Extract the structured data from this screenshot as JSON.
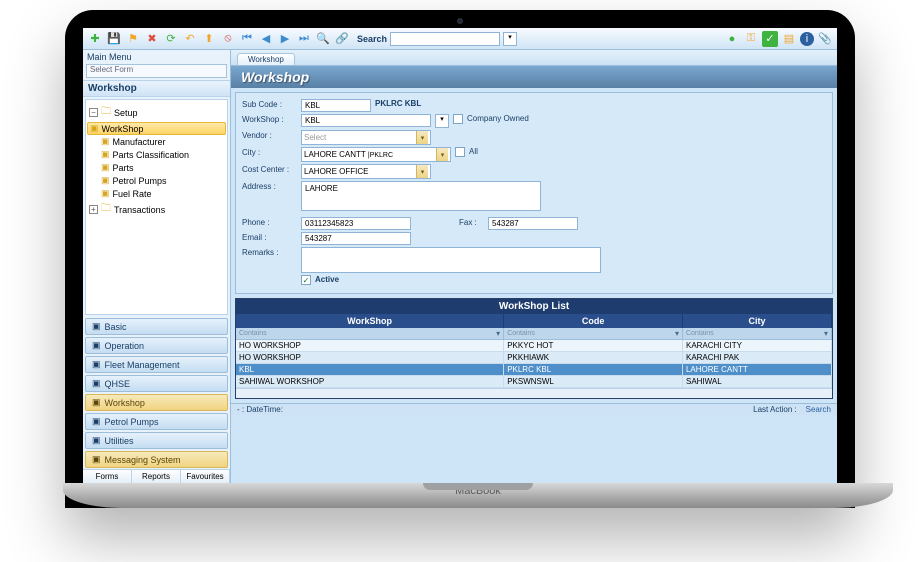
{
  "toolbar": {
    "search_label": "Search",
    "search_value": ""
  },
  "sidebar": {
    "main_menu": "Main Menu",
    "select_form": "Select Form",
    "module_title": "Workshop",
    "tree": {
      "root": "Setup",
      "children": [
        "WorkShop",
        "Manufacturer",
        "Parts Classification",
        "Parts",
        "Petrol Pumps",
        "Fuel Rate"
      ],
      "sibling": "Transactions"
    },
    "stack": [
      "Basic",
      "Operation",
      "Fleet Management",
      "QHSE",
      "Workshop",
      "Petrol Pumps",
      "Utilities",
      "Messaging System"
    ],
    "bottom_tabs": [
      "Forms",
      "Reports",
      "Favourites"
    ]
  },
  "content": {
    "tab": "Workshop",
    "title": "Workshop",
    "form": {
      "sub_code_label": "Sub Code :",
      "sub_code_value": "KBL",
      "sub_code_display": "PKLRC KBL",
      "workshop_label": "WorkShop :",
      "workshop_value": "KBL",
      "company_owned": "Company Owned",
      "vendor_label": "Vendor :",
      "vendor_value": "Select",
      "city_label": "City :",
      "city_value": "LAHORE CANTT",
      "city_code": "|PKLRC",
      "all": "All",
      "costcenter_label": "Cost Center :",
      "costcenter_value": "LAHORE OFFICE",
      "address_label": "Address :",
      "address_value": "LAHORE",
      "phone_label": "Phone :",
      "phone_value": "03112345823",
      "fax_label": "Fax :",
      "fax_value": "543287",
      "email_label": "Email :",
      "email_value": "543287",
      "remarks_label": "Remarks :",
      "remarks_value": "",
      "active": "Active"
    },
    "list": {
      "title": "WorkShop List",
      "headers": [
        "WorkShop",
        "Code",
        "City"
      ],
      "filter_hint": "Contains",
      "rows": [
        {
          "ws": "HO  WORKSHOP",
          "code": "PKKYC HOT",
          "city": "KARACHI CITY",
          "sel": false
        },
        {
          "ws": "HO WORKSHOP",
          "code": "PKKHIAWK",
          "city": "KARACHI PAK",
          "sel": false
        },
        {
          "ws": "KBL",
          "code": "PKLRC KBL",
          "city": "LAHORE CANTT",
          "sel": true
        },
        {
          "ws": "SAHIWAL WORKSHOP",
          "code": "PKSWNSWL",
          "city": "SAHIWAL",
          "sel": false
        }
      ]
    },
    "footer": {
      "datetime_label": "- : DateTime:",
      "last_action": "Last Action :",
      "search": "Search"
    }
  }
}
